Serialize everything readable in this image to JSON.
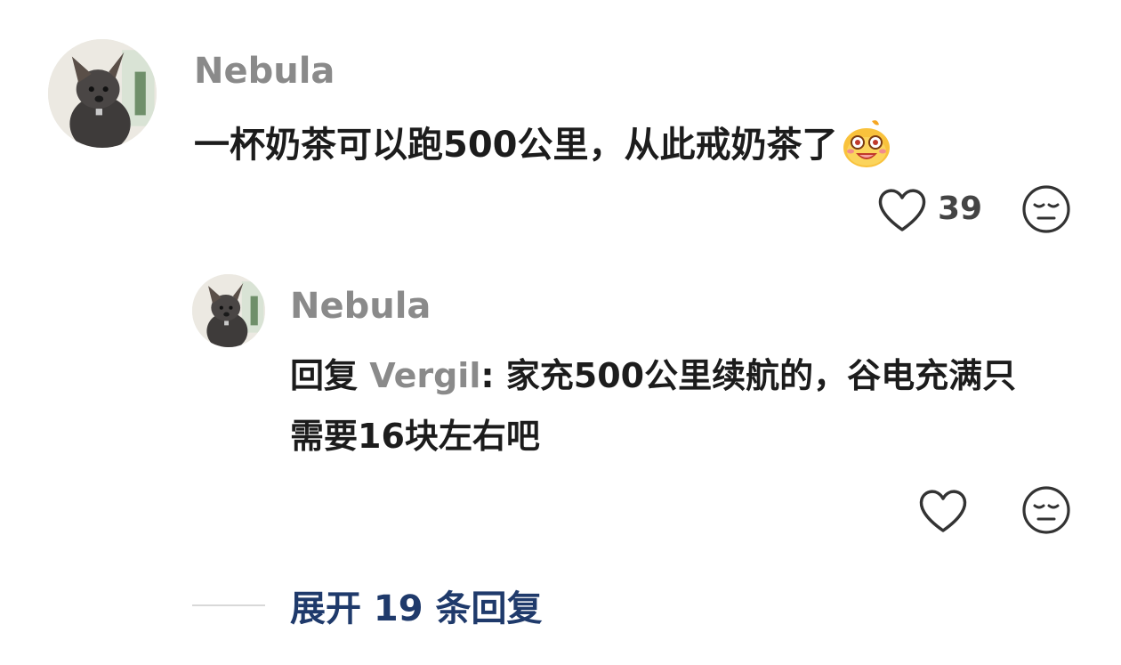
{
  "comment": {
    "username": "Nebula",
    "text": "一杯奶茶可以跑500公里，从此戒奶茶了",
    "emoji": "laughing-face-emoji",
    "like_count": "39"
  },
  "reply": {
    "username": "Nebula",
    "prefix": "回复",
    "mention": "Vergil",
    "separator": ":",
    "text": "家充500公里续航的，谷电充满只需要16块左右吧"
  },
  "expand_replies": {
    "label": "展开 19 条回复"
  },
  "icons": {
    "like": "heart-icon",
    "dislike": "meh-face-icon",
    "avatar": "avatar-dog-photo"
  },
  "colors": {
    "username": "#8a8a8a",
    "text": "#1c1c1c",
    "link": "#1f3a6b",
    "icon_stroke": "#333333"
  }
}
